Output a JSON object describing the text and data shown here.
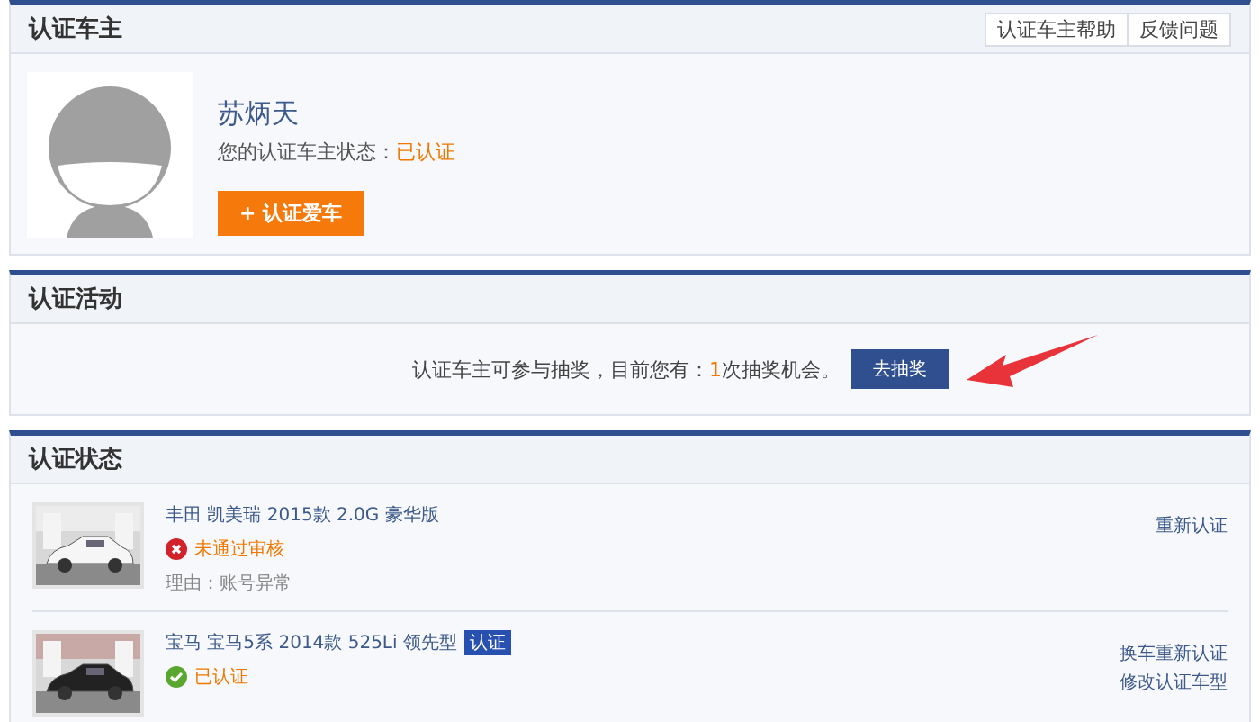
{
  "owner_section": {
    "title": "认证车主",
    "header_buttons": [
      "认证车主帮助",
      "反馈问题"
    ],
    "name": "苏炳天",
    "status_label": "您的认证车主状态：",
    "status_value": "已认证",
    "add_button": "+ 认证爱车"
  },
  "activity_section": {
    "title": "认证活动",
    "text_before": "认证车主可参与抽奖，目前您有：",
    "count": "1",
    "text_after": "次抽奖机会。",
    "button": "去抽奖"
  },
  "status_section": {
    "title": "认证状态",
    "cars": [
      {
        "model": "丰田 凯美瑞 2015款 2.0G 豪华版",
        "kind": "rejected",
        "status_text": "未通过审核",
        "reason": "理由：账号异常",
        "links": [
          "重新认证"
        ]
      },
      {
        "model": "宝马 宝马5系 2014款 525Li 领先型",
        "badge": "认证",
        "kind": "approved",
        "status_text": "已认证",
        "links": [
          "换车重新认证",
          "修改认证车型"
        ]
      }
    ]
  }
}
